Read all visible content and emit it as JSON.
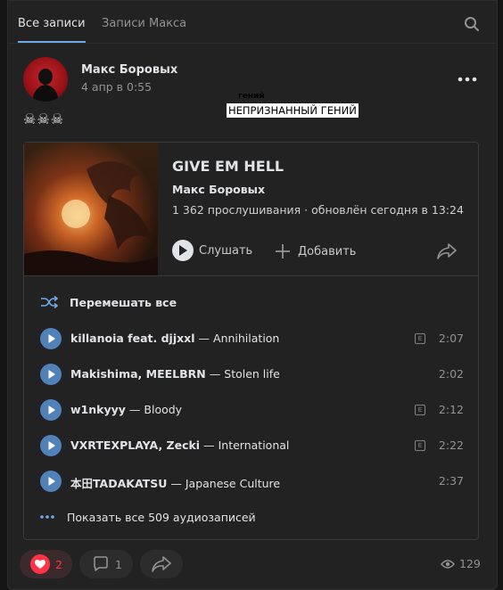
{
  "tabs": [
    {
      "label": "Все записи"
    },
    {
      "label": "Записи Макса"
    }
  ],
  "post": {
    "author": "Макс Боровых",
    "date": "4 апр в 0:55",
    "status_small": "гений",
    "status_box": "НЕПРИЗНАННЫЙ ГЕНИЙ",
    "text": "☠☠☠"
  },
  "playlist": {
    "title": "GIVE EM HELL",
    "owner": "Макс Боровых",
    "stats": "1 362 прослушивания · обновлён сегодня в 13:24",
    "listen_label": "Слушать",
    "add_label": "Добавить",
    "shuffle_label": "Перемешать все",
    "show_all_label": "Показать все 509 аудиозаписей",
    "explicit_mark": "E",
    "tracks": [
      {
        "artist": "killanoia feat. djjxxl",
        "title": "Annihilation",
        "duration": "2:07",
        "explicit": true
      },
      {
        "artist": "Makishima, MEELBRN",
        "title": "Stolen life",
        "duration": "2:02",
        "explicit": false
      },
      {
        "artist": "w1nkyyy",
        "title": "Bloody",
        "duration": "2:12",
        "explicit": true
      },
      {
        "artist": "VXRTEXPLAYA, Zecki",
        "title": "International",
        "duration": "2:22",
        "explicit": true
      },
      {
        "artist": "本田TADAKATSU",
        "title": "Japanese Culture",
        "duration": "2:37",
        "explicit": false
      }
    ]
  },
  "footer": {
    "likes": "2",
    "comments": "1",
    "views": "129"
  },
  "colors": {
    "accent": "#71aaeb",
    "play_button": "#5181b8",
    "like_red": "#ff3347",
    "background": "#222222"
  },
  "icons": [
    "search-icon",
    "more-icon",
    "play-icon",
    "plus-icon",
    "share-icon",
    "shuffle-icon",
    "dots-icon",
    "heart-icon",
    "comment-icon",
    "eye-icon"
  ]
}
